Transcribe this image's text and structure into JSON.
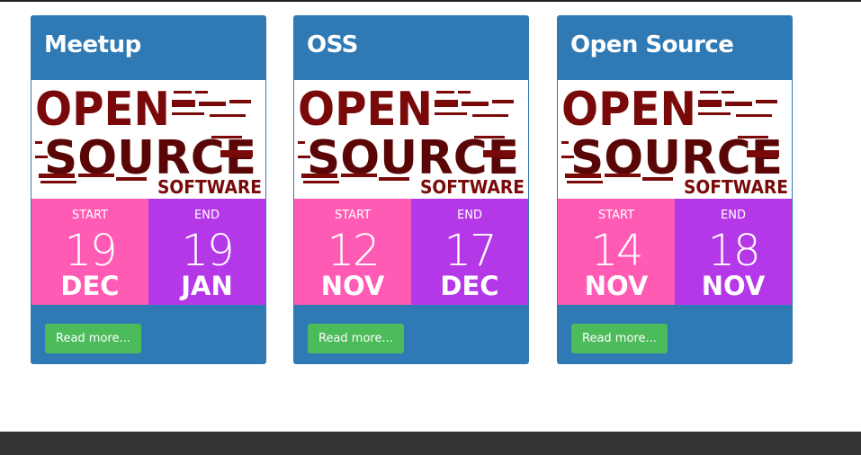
{
  "events": [
    {
      "title": "Meetup",
      "image_alt": "OPEN SOURCE SOFTWARE",
      "start_label": "START",
      "start_day": "19",
      "start_month": "DEC",
      "end_label": "END",
      "end_day": "19",
      "end_month": "JAN",
      "button_label": "Read more..."
    },
    {
      "title": "OSS",
      "image_alt": "OPEN SOURCE SOFTWARE",
      "start_label": "START",
      "start_day": "12",
      "start_month": "NOV",
      "end_label": "END",
      "end_day": "17",
      "end_month": "DEC",
      "button_label": "Read more..."
    },
    {
      "title": "Open Source",
      "image_alt": "OPEN SOURCE SOFTWARE",
      "start_label": "START",
      "start_day": "14",
      "start_month": "NOV",
      "end_label": "END",
      "end_day": "18",
      "end_month": "NOV",
      "button_label": "Read more..."
    }
  ],
  "colors": {
    "card_background": "#2f7ab5",
    "start_background": "#ff5bb4",
    "end_background": "#b538e8",
    "button_background": "#4cbb59",
    "footer_background": "#333333",
    "logo_red": "#7a0a0a"
  }
}
